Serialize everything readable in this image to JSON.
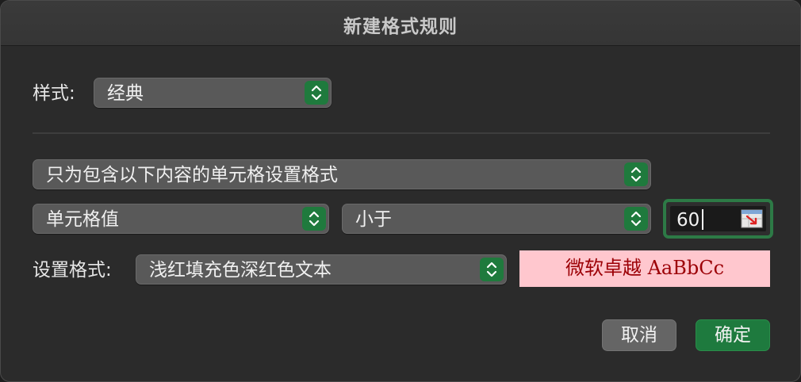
{
  "dialog": {
    "title": "新建格式规则"
  },
  "style_row": {
    "label": "样式:",
    "value": "经典"
  },
  "rule": {
    "rule_type": "只为包含以下内容的单元格设置格式",
    "condition_subject": "单元格值",
    "operator": "小于",
    "value": "60"
  },
  "format_row": {
    "label": "设置格式:",
    "value": "浅红填充色深红色文本",
    "preview_text": "微软卓越 AaBbCc",
    "preview_fill": "#ffc7ce",
    "preview_text_color": "#9c0006"
  },
  "buttons": {
    "cancel": "取消",
    "ok": "确定"
  },
  "colors": {
    "accent_green": "#1e7a3e",
    "dialog_bg": "#2b2b2b"
  },
  "icons": {
    "popup_arrows": "up-down-chevron-icon",
    "range_picker": "collapse-dialog-icon"
  }
}
